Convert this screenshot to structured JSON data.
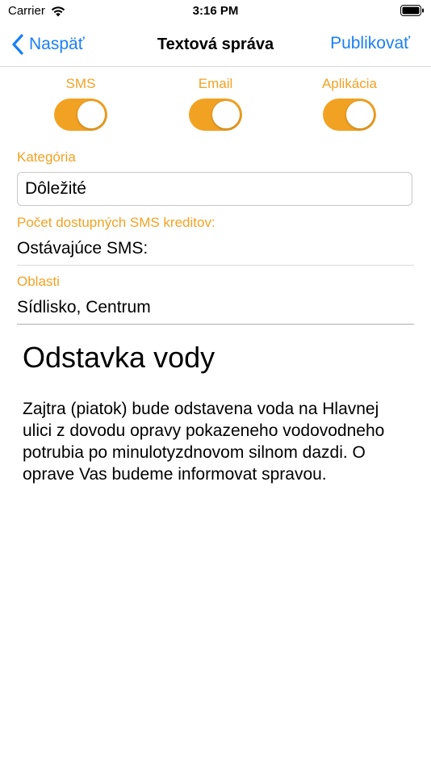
{
  "status_bar": {
    "carrier": "Carrier",
    "time": "3:16 PM"
  },
  "nav": {
    "back_label": "Naspäť",
    "title": "Textová správa",
    "publish_label": "Publikovať"
  },
  "toggles": [
    {
      "label": "SMS",
      "on": true
    },
    {
      "label": "Email",
      "on": true
    },
    {
      "label": "Aplikácia",
      "on": true
    }
  ],
  "category": {
    "label": "Kategória",
    "value": "Dôležité"
  },
  "sms_credits": {
    "label": "Počet dostupných SMS kreditov:",
    "value_text": "Ostávajúce SMS:"
  },
  "areas": {
    "label": "Oblasti",
    "value": "Sídlisko, Centrum"
  },
  "message": {
    "title": "Odstavka vody",
    "body": "Zajtra (piatok) bude odstavena voda na Hlavnej ulici z dovodu opravy pokazeneho vodovodneho potrubia po minulotyzdnovom silnom dazdi. O oprave Vas budeme informovat spravou."
  },
  "colors": {
    "accent": "#f2a223",
    "link": "#1a7ff5"
  }
}
